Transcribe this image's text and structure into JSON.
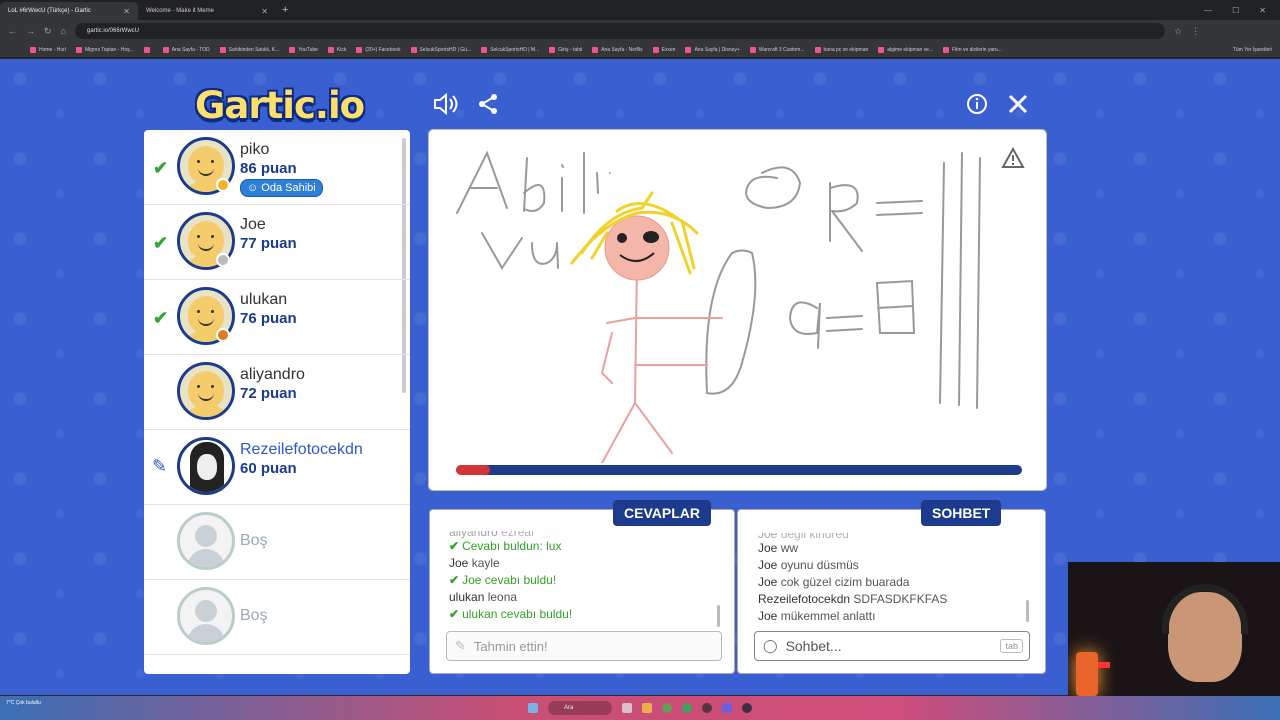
{
  "browser": {
    "tabs": [
      {
        "label": "LoL #6rWwcU (Türkçe) - Gartic",
        "active": true
      },
      {
        "label": "Welcome - Make it Meme",
        "active": false
      }
    ],
    "url": "gartic.io/066rWwcU",
    "bookmarks": [
      "Home - Hurl",
      "Migros Toptan - Hoş...",
      "",
      "Ana Sayfa - TOD",
      "Sahibinden Satılık, K...",
      "YouTube",
      "Kick",
      "(20+) Facebook",
      "SelcukSportsHD | Gü...",
      "SelcukSportsHD | M...",
      "Giriş - tabii",
      "Ana Sayfa - Netflix",
      "Exxen",
      "Ana Sayfa | Disney+",
      "Warcraft 3 Custom...",
      "bana pc ve ekipman",
      "algime ekipman ve...",
      "Film ve dizilerin yaru..."
    ],
    "bookmarks_right": "Tüm Yer İşaretleri"
  },
  "game": {
    "logo": "Gartic.io",
    "players": [
      {
        "name": "piko",
        "score": "86 puan",
        "guessed": true,
        "badge": "Oda Sahibi",
        "status_color": "#f0b429"
      },
      {
        "name": "Joe",
        "score": "77 puan",
        "guessed": true,
        "status_color": "#bbbbbb"
      },
      {
        "name": "ulukan",
        "score": "76 puan",
        "guessed": true,
        "status_color": "#e07b20"
      },
      {
        "name": "aliyandro",
        "score": "72 puan",
        "guessed": false
      },
      {
        "name": "Rezeilefotocekdn",
        "score": "60 puan",
        "guessed": false,
        "drawing": true
      },
      {
        "name": "Boş",
        "empty": true
      },
      {
        "name": "Boş",
        "empty": true
      }
    ],
    "timer_progress": 0.06,
    "answers": {
      "title": "CEVAPLAR",
      "messages": [
        {
          "user": "aliyandro",
          "text": "ezreal"
        },
        {
          "user": "",
          "text": "Cevabı buldun: lux",
          "correct": true
        },
        {
          "user": "Joe",
          "text": "kayle"
        },
        {
          "user": "Joe",
          "text": "cevabı buldu!",
          "correct": true
        },
        {
          "user": "ulukan",
          "text": "leona"
        },
        {
          "user": "ulukan",
          "text": "cevabı buldu!",
          "correct": true
        }
      ],
      "placeholder": "Tahmin ettin!"
    },
    "chat": {
      "title": "SOHBET",
      "messages": [
        {
          "user": "Joe",
          "text": "degil kindred"
        },
        {
          "user": "Joe",
          "text": "ww"
        },
        {
          "user": "Joe",
          "text": "oyunu düsmüs"
        },
        {
          "user": "Joe",
          "text": "cok güzel cizim buarada"
        },
        {
          "user": "Rezeilefotocekdn",
          "text": "SDFASDKFKFAS"
        },
        {
          "user": "Joe",
          "text": "mükemmel anlattı"
        }
      ],
      "placeholder": "Sohbet...",
      "tab_hint": "tab"
    }
  },
  "taskbar": {
    "weather": "7°C\nÇok bulutlu",
    "search": "Ara"
  }
}
